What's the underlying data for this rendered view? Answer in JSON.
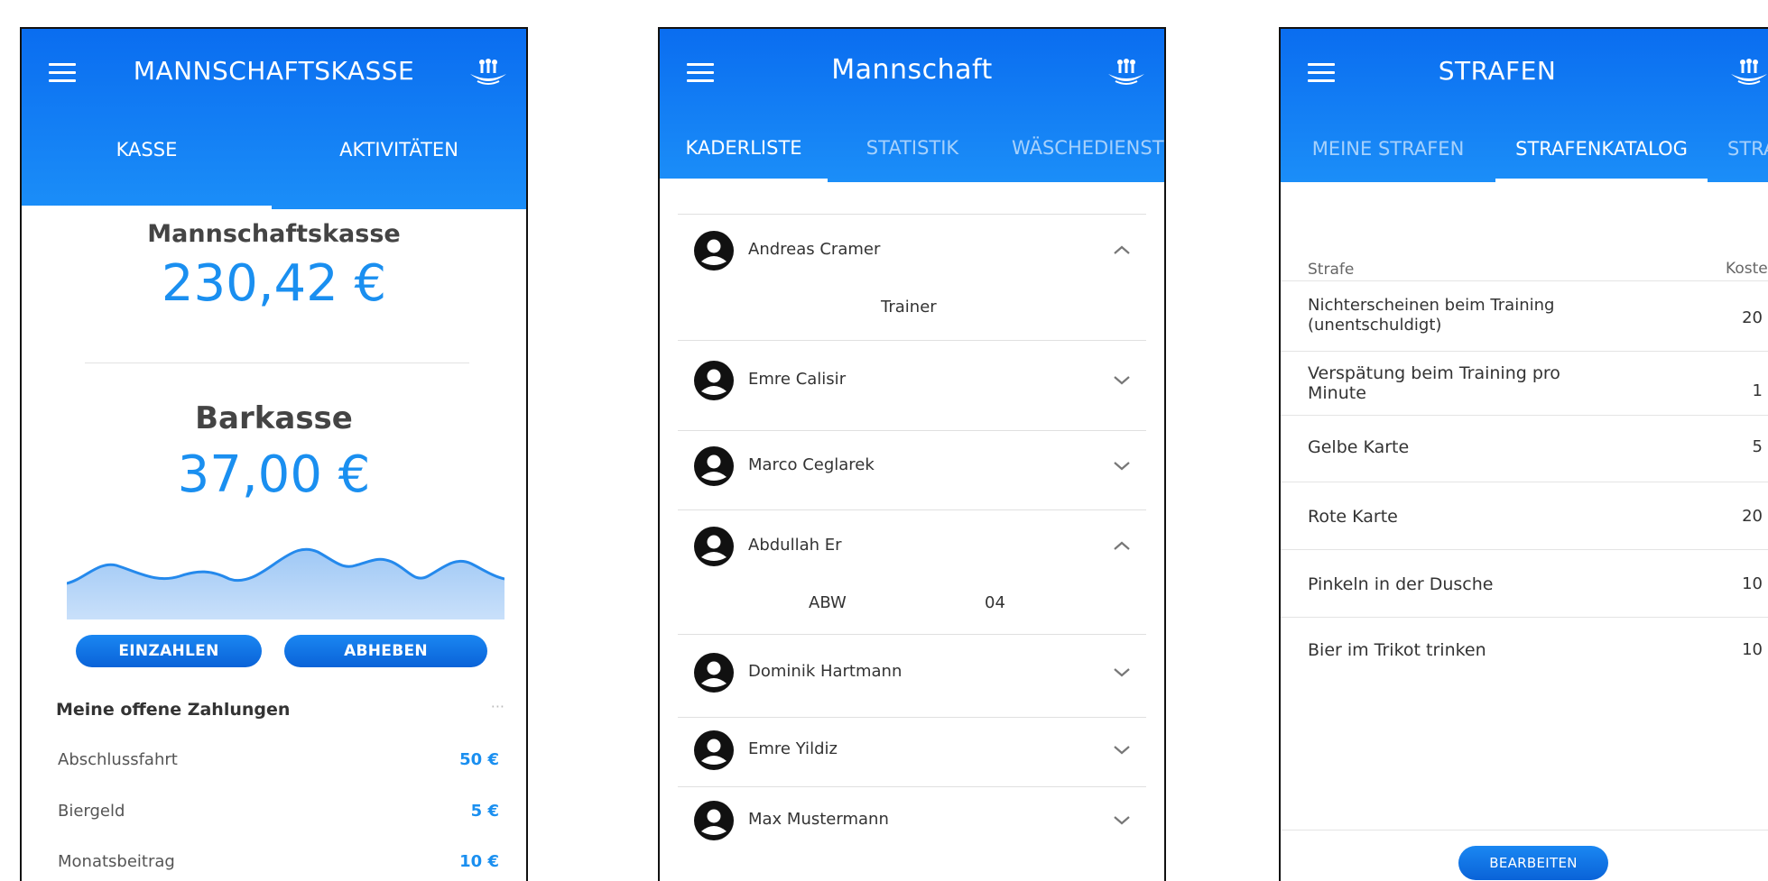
{
  "kasse_screen": {
    "title": "MANNSCHAFTSKASSE",
    "tabs": [
      "KASSE",
      "AKTIVITÄTEN"
    ],
    "team_fund_label": "Mannschaftskasse",
    "team_fund_amount": "230,42 €",
    "cash_label": "Barkasse",
    "cash_amount": "37,00 €",
    "deposit_button": "EINZAHLEN",
    "withdraw_button": "ABHEBEN",
    "open_payments_heading": "Meine offene Zahlungen",
    "more_label": "···",
    "payments": [
      {
        "name": "Abschlussfahrt",
        "amount": "50 €"
      },
      {
        "name": "Biergeld",
        "amount": "5 €"
      },
      {
        "name": "Monatsbeitrag",
        "amount": "10 €"
      }
    ]
  },
  "team_screen": {
    "title": "Mannschaft",
    "tabs": [
      "KADERLISTE",
      "STATISTIK",
      "WÄSCHEDIENST"
    ],
    "members": [
      {
        "name": "Andreas Cramer",
        "expanded": true,
        "detail": "Trainer"
      },
      {
        "name": "Emre Calisir",
        "expanded": false
      },
      {
        "name": "Marco Ceglarek",
        "expanded": false
      },
      {
        "name": "Abdullah Er",
        "expanded": true,
        "position": "ABW",
        "number": "04"
      },
      {
        "name": "Dominik Hartmann",
        "expanded": false
      },
      {
        "name": "Emre Yildiz",
        "expanded": false
      },
      {
        "name": "Max Mustermann",
        "expanded": false
      }
    ]
  },
  "penalty_screen": {
    "title": "STRAFEN",
    "tabs": [
      "MEINE STRAFEN",
      "STRAFENKATALOG",
      "STRAFEN"
    ],
    "col_penalty": "Strafe",
    "col_cost": "Kosten (€)",
    "penalties": [
      {
        "name": "Nichterscheinen beim Training (unentschuldigt)",
        "cost": "20"
      },
      {
        "name": "Verspätung beim Training pro Minute",
        "cost": "1"
      },
      {
        "name": "Gelbe Karte",
        "cost": "5"
      },
      {
        "name": "Rote Karte",
        "cost": "20"
      },
      {
        "name": "Pinkeln in der Dusche",
        "cost": "10"
      },
      {
        "name": "Bier im Trikot trinken",
        "cost": "10"
      }
    ],
    "edit_button": "BEARBEITEN"
  },
  "colors": {
    "primary": "#0a6df0",
    "accent": "#1a8ff0",
    "text": "#333333"
  },
  "icons": [
    "menu-icon",
    "team-logo-icon",
    "avatar-icon",
    "chevron-up-icon",
    "chevron-down-icon"
  ]
}
